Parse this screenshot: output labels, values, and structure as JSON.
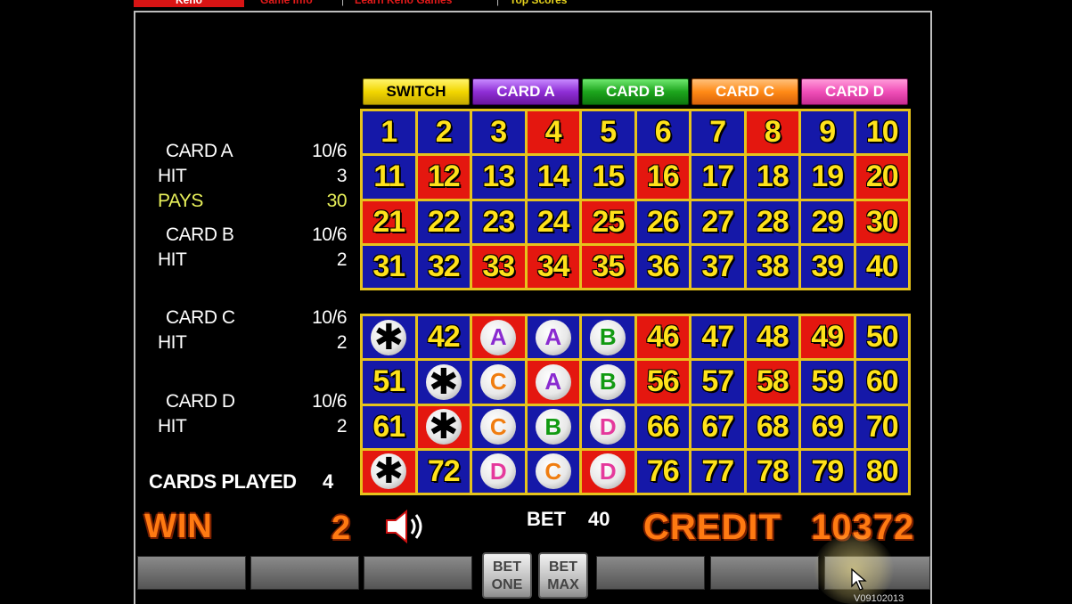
{
  "nav": {
    "active": "Keno",
    "links": [
      "Game Info",
      "Learn Keno Games",
      "Top Scores"
    ]
  },
  "tabs": {
    "switch": "SWITCH",
    "card_a": "CARD A",
    "card_b": "CARD B",
    "card_c": "CARD C",
    "card_d": "CARD D"
  },
  "stats": {
    "card_a": {
      "label": "CARD A",
      "odds": "10/6",
      "hit_label": "HIT",
      "hit": "3",
      "pays_label": "PAYS",
      "pays": "30"
    },
    "card_b": {
      "label": "CARD B",
      "odds": "10/6",
      "hit_label": "HIT",
      "hit": "2"
    },
    "card_c": {
      "label": "CARD C",
      "odds": "10/6",
      "hit_label": "HIT",
      "hit": "2"
    },
    "card_d": {
      "label": "CARD D",
      "odds": "10/6",
      "hit_label": "HIT",
      "hit": "2"
    },
    "cards_played_label": "CARDS PLAYED",
    "cards_played": "4"
  },
  "status": {
    "win_label": "WIN",
    "win": "2",
    "bet_label": "BET",
    "bet": "40",
    "credit_label": "CREDIT",
    "credit": "10372"
  },
  "buttons": {
    "bet_one": "BET ONE",
    "bet_max": "BET MAX"
  },
  "version": "V09102013",
  "colors": {
    "cell_blue": "#1518a8",
    "cell_red": "#e4170f",
    "number": "#ffe21a",
    "grid": "#e6c31c",
    "win_credit": "#ff7a12"
  },
  "board_top": [
    {
      "n": "1",
      "c": "blue"
    },
    {
      "n": "2",
      "c": "blue"
    },
    {
      "n": "3",
      "c": "blue"
    },
    {
      "n": "4",
      "c": "red"
    },
    {
      "n": "5",
      "c": "blue"
    },
    {
      "n": "6",
      "c": "blue"
    },
    {
      "n": "7",
      "c": "blue"
    },
    {
      "n": "8",
      "c": "red"
    },
    {
      "n": "9",
      "c": "blue"
    },
    {
      "n": "10",
      "c": "blue"
    },
    {
      "n": "11",
      "c": "blue"
    },
    {
      "n": "12",
      "c": "red"
    },
    {
      "n": "13",
      "c": "blue"
    },
    {
      "n": "14",
      "c": "blue"
    },
    {
      "n": "15",
      "c": "blue"
    },
    {
      "n": "16",
      "c": "red"
    },
    {
      "n": "17",
      "c": "blue"
    },
    {
      "n": "18",
      "c": "blue"
    },
    {
      "n": "19",
      "c": "blue"
    },
    {
      "n": "20",
      "c": "red"
    },
    {
      "n": "21",
      "c": "red"
    },
    {
      "n": "22",
      "c": "blue"
    },
    {
      "n": "23",
      "c": "blue"
    },
    {
      "n": "24",
      "c": "blue"
    },
    {
      "n": "25",
      "c": "red"
    },
    {
      "n": "26",
      "c": "blue"
    },
    {
      "n": "27",
      "c": "blue"
    },
    {
      "n": "28",
      "c": "blue"
    },
    {
      "n": "29",
      "c": "blue"
    },
    {
      "n": "30",
      "c": "red"
    },
    {
      "n": "31",
      "c": "blue"
    },
    {
      "n": "32",
      "c": "blue"
    },
    {
      "n": "33",
      "c": "red"
    },
    {
      "n": "34",
      "c": "red"
    },
    {
      "n": "35",
      "c": "red"
    },
    {
      "n": "36",
      "c": "blue"
    },
    {
      "n": "37",
      "c": "blue"
    },
    {
      "n": "38",
      "c": "blue"
    },
    {
      "n": "39",
      "c": "blue"
    },
    {
      "n": "40",
      "c": "blue"
    }
  ],
  "board_bottom": [
    {
      "m": "star",
      "c": "blue"
    },
    {
      "n": "42",
      "c": "blue"
    },
    {
      "m": "A",
      "c": "red"
    },
    {
      "m": "A",
      "c": "blue"
    },
    {
      "m": "B",
      "c": "blue"
    },
    {
      "n": "46",
      "c": "red"
    },
    {
      "n": "47",
      "c": "blue"
    },
    {
      "n": "48",
      "c": "blue"
    },
    {
      "n": "49",
      "c": "red"
    },
    {
      "n": "50",
      "c": "blue"
    },
    {
      "n": "51",
      "c": "blue"
    },
    {
      "m": "star",
      "c": "blue"
    },
    {
      "m": "C",
      "c": "blue"
    },
    {
      "m": "A",
      "c": "red"
    },
    {
      "m": "B",
      "c": "blue"
    },
    {
      "n": "56",
      "c": "red"
    },
    {
      "n": "57",
      "c": "blue"
    },
    {
      "n": "58",
      "c": "red"
    },
    {
      "n": "59",
      "c": "blue"
    },
    {
      "n": "60",
      "c": "blue"
    },
    {
      "n": "61",
      "c": "blue"
    },
    {
      "m": "star",
      "c": "red"
    },
    {
      "m": "C",
      "c": "blue"
    },
    {
      "m": "B",
      "c": "blue"
    },
    {
      "m": "D",
      "c": "blue"
    },
    {
      "n": "66",
      "c": "blue"
    },
    {
      "n": "67",
      "c": "blue"
    },
    {
      "n": "68",
      "c": "blue"
    },
    {
      "n": "69",
      "c": "blue"
    },
    {
      "n": "70",
      "c": "blue"
    },
    {
      "m": "star",
      "c": "red"
    },
    {
      "n": "72",
      "c": "blue"
    },
    {
      "m": "D",
      "c": "blue"
    },
    {
      "m": "C",
      "c": "blue"
    },
    {
      "m": "D",
      "c": "red"
    },
    {
      "n": "76",
      "c": "blue"
    },
    {
      "n": "77",
      "c": "blue"
    },
    {
      "n": "78",
      "c": "blue"
    },
    {
      "n": "79",
      "c": "blue"
    },
    {
      "n": "80",
      "c": "blue"
    }
  ]
}
